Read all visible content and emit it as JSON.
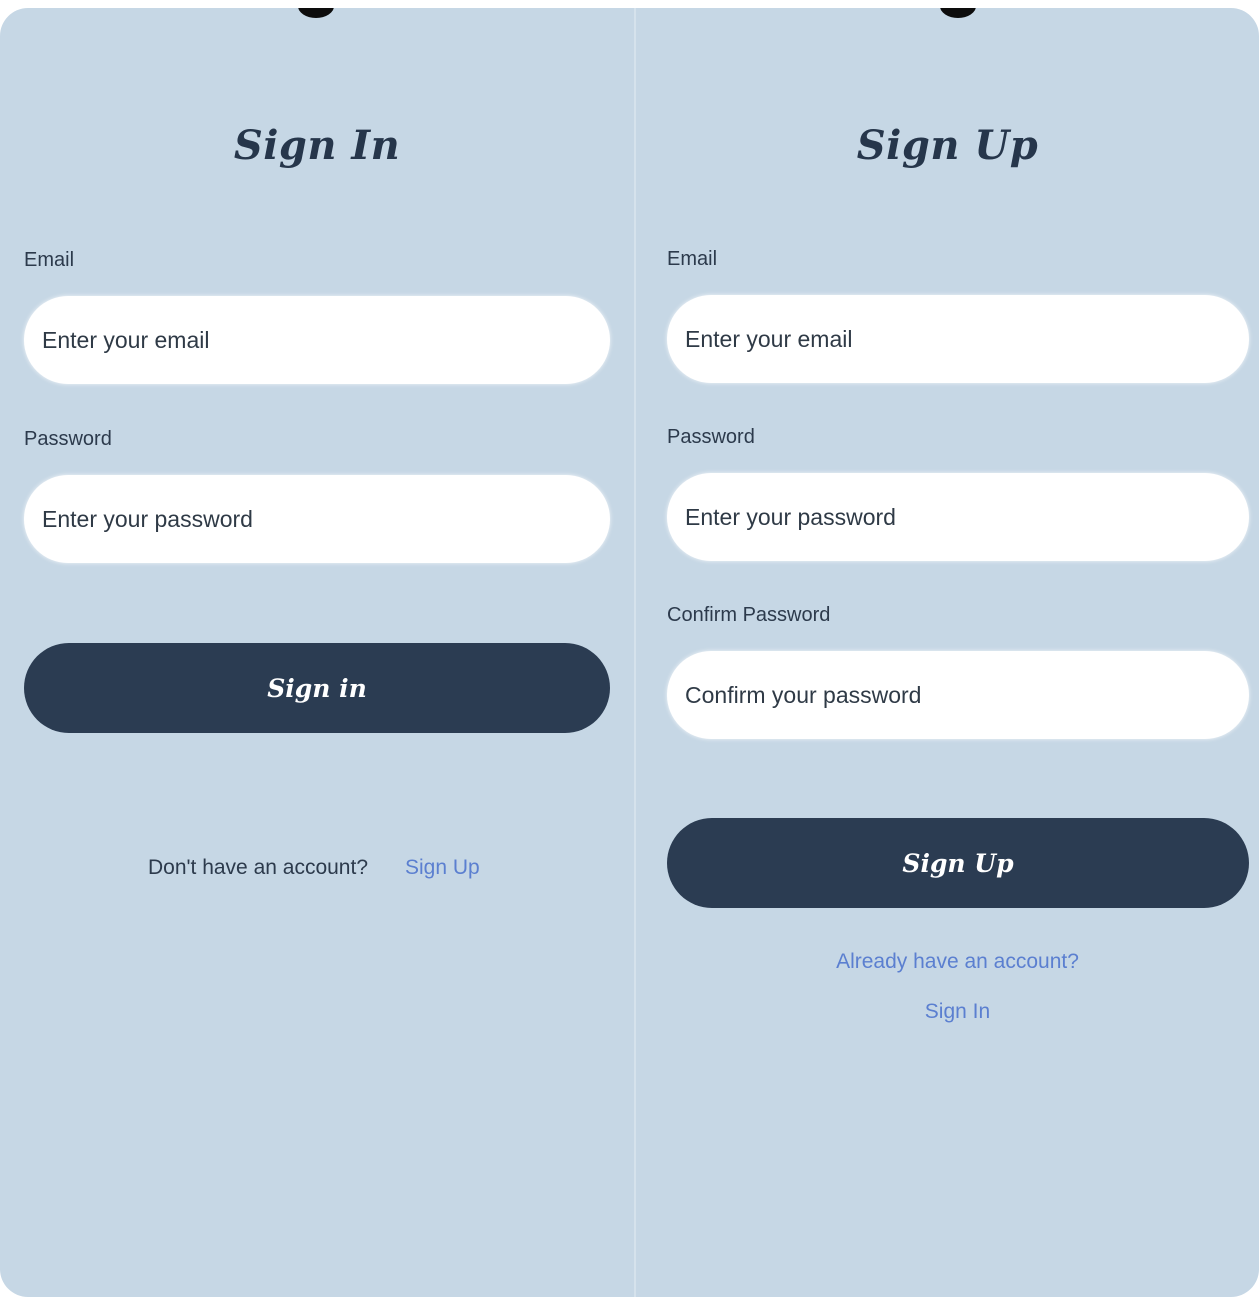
{
  "colors": {
    "background": "#c6d7e5",
    "primary_button": "#2b3c52",
    "title_text": "#26364b",
    "link": "#5b7fd0",
    "input_bg": "#ffffff"
  },
  "signin": {
    "title": "Sign In",
    "email_label": "Email",
    "email_placeholder": "Enter your email",
    "password_label": "Password",
    "password_placeholder": "Enter your password",
    "button_label": "Sign in",
    "footer_text": "Don't have an account?",
    "footer_link": "Sign Up"
  },
  "signup": {
    "title": "Sign Up",
    "email_label": "Email",
    "email_placeholder": "Enter your email",
    "password_label": "Password",
    "password_placeholder": "Enter your password",
    "confirm_label": "Confirm Password",
    "confirm_placeholder": "Confirm your password",
    "button_label": "Sign Up",
    "footer_text": "Already have an account?",
    "footer_link": "Sign In"
  }
}
